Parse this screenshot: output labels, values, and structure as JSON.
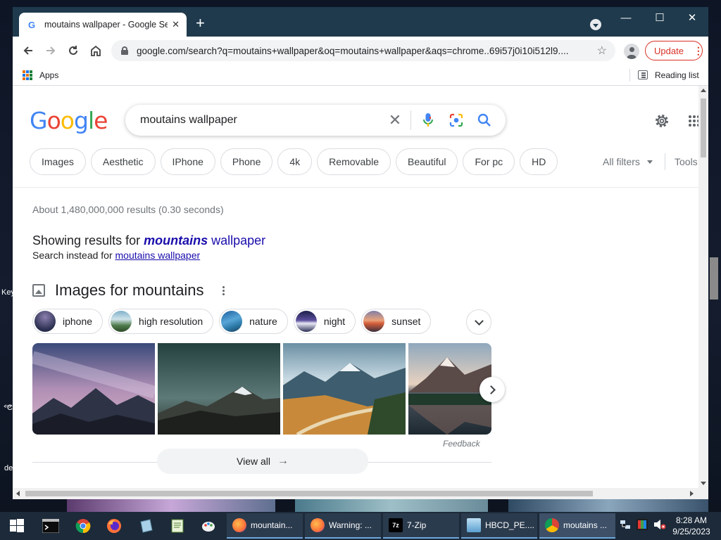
{
  "window": {
    "tab_title": "moutains wallpaper - Google Sea",
    "url": "google.com/search?q=moutains+wallpaper&oq=moutains+wallpaper&aqs=chrome..69i57j0i10i512l9....",
    "update_label": "Update",
    "bookmarks": {
      "apps_label": "Apps",
      "reading_list_label": "Reading list"
    }
  },
  "search": {
    "query": "moutains wallpaper",
    "filter_chips": [
      "Images",
      "Aesthetic",
      "IPhone",
      "Phone",
      "4k",
      "Removable",
      "Beautiful",
      "For pc",
      "HD"
    ],
    "all_filters_label": "All filters",
    "tools_label": "Tools"
  },
  "results": {
    "stats": "About 1,480,000,000 results (0.30 seconds)",
    "showing_prefix": "Showing results for",
    "corrected_bold": "mountains",
    "corrected_rest": "wallpaper",
    "instead_prefix": "Search instead for",
    "instead_link": "moutains wallpaper"
  },
  "images_section": {
    "title": "Images for mountains",
    "refine_chips": [
      "iphone",
      "high resolution",
      "nature",
      "night",
      "sunset"
    ],
    "feedback_label": "Feedback",
    "view_all_label": "View all"
  },
  "desktop": {
    "side_labels": [
      "Key",
      "C",
      "de"
    ]
  },
  "taskbar": {
    "buttons": [
      "mountain...",
      "Warning: ...",
      "7-Zip",
      "HBCD_PE....",
      "moutains ..."
    ],
    "time": "8:28 AM",
    "date": "9/25/2023"
  },
  "colors": {
    "titlebar": "#1f3a4d",
    "link": "#1a0dab",
    "update_red": "#d93025",
    "google_blue": "#4285f4",
    "google_red": "#ea4335",
    "google_yellow": "#fbbc05",
    "google_green": "#34a853"
  }
}
